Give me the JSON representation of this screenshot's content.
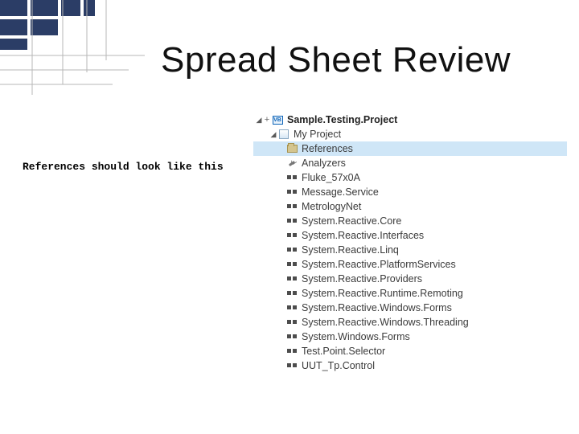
{
  "title": "Spread Sheet Review",
  "caption": "References should look like this",
  "tree": {
    "project": {
      "label": "Sample.Testing.Project",
      "vb_badge": "VB"
    },
    "myproject": "My Project",
    "references": "References",
    "analyzers": "Analyzers",
    "items": [
      "Fluke_57x0A",
      "Message.Service",
      "MetrologyNet",
      "System.Reactive.Core",
      "System.Reactive.Interfaces",
      "System.Reactive.Linq",
      "System.Reactive.PlatformServices",
      "System.Reactive.Providers",
      "System.Reactive.Runtime.Remoting",
      "System.Reactive.Windows.Forms",
      "System.Reactive.Windows.Threading",
      "System.Windows.Forms",
      "Test.Point.Selector",
      "UUT_Tp.Control"
    ]
  }
}
